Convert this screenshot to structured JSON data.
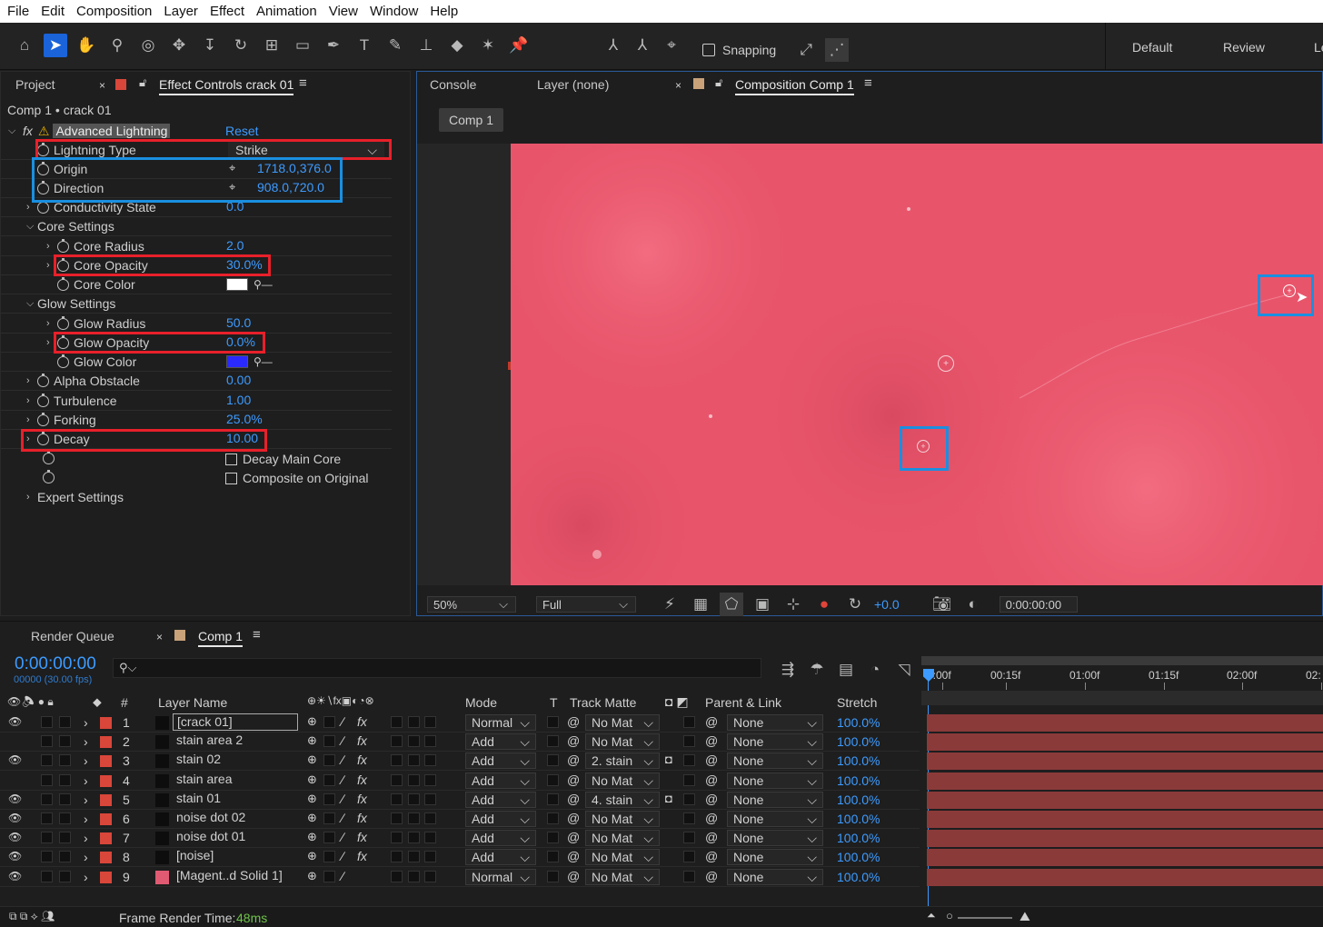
{
  "menu": [
    "File",
    "Edit",
    "Composition",
    "Layer",
    "Effect",
    "Animation",
    "View",
    "Window",
    "Help"
  ],
  "toolbar": {
    "snapping": "Snapping",
    "workspaces": [
      "Default",
      "Review",
      "Le"
    ]
  },
  "project": {
    "tab_project": "Project",
    "tab_effect": "Effect Controls crack 01",
    "breadcrumb": "Comp 1 • crack 01"
  },
  "effect": {
    "name": "Advanced Lightning",
    "reset": "Reset",
    "props": [
      {
        "label": "Lightning Type",
        "value": "Strike",
        "indent": 1,
        "chev": false
      },
      {
        "label": "Origin",
        "value": "1718.0,376.0",
        "indent": 1,
        "chev": false,
        "target": true
      },
      {
        "label": "Direction",
        "value": "908.0,720.0",
        "indent": 1,
        "chev": false,
        "target": true
      },
      {
        "label": "Conductivity State",
        "value": "0.0",
        "indent": 1,
        "chev": true
      },
      {
        "label": "Core Settings",
        "value": "",
        "indent": 0,
        "group": true
      },
      {
        "label": "Core Radius",
        "value": "2.0",
        "indent": 2,
        "chev": true
      },
      {
        "label": "Core Opacity",
        "value": "30.0%",
        "indent": 2,
        "chev": true
      },
      {
        "label": "Core Color",
        "value": "",
        "indent": 2,
        "chev": false,
        "color": "#ffffff"
      },
      {
        "label": "Glow Settings",
        "value": "",
        "indent": 0,
        "group": true
      },
      {
        "label": "Glow Radius",
        "value": "50.0",
        "indent": 2,
        "chev": true
      },
      {
        "label": "Glow Opacity",
        "value": "0.0%",
        "indent": 2,
        "chev": true
      },
      {
        "label": "Glow Color",
        "value": "",
        "indent": 2,
        "chev": false,
        "color": "#2a2aff"
      },
      {
        "label": "Alpha Obstacle",
        "value": "0.00",
        "indent": 1,
        "chev": true
      },
      {
        "label": "Turbulence",
        "value": "1.00",
        "indent": 1,
        "chev": true
      },
      {
        "label": "Forking",
        "value": "25.0%",
        "indent": 1,
        "chev": true
      },
      {
        "label": "Decay",
        "value": "10.00",
        "indent": 1,
        "chev": true
      }
    ],
    "check1": "Decay Main Core",
    "check2": "Composite on Original",
    "expert": "Expert Settings"
  },
  "comp": {
    "tab_console": "Console",
    "tab_layer": "Layer (none)",
    "tab_comp": "Composition Comp 1",
    "chip": "Comp 1",
    "zoom": "50%",
    "res": "Full",
    "exposure": "+0.0",
    "time": "0:00:00:00"
  },
  "timeline": {
    "tab_rq": "Render Queue",
    "tab_comp": "Comp 1",
    "time": "0:00:00:00",
    "fps": "00000 (30.00 fps)",
    "search_placeholder": "",
    "cols": {
      "num": "#",
      "name": "Layer Name",
      "mode": "Mode",
      "t": "T",
      "matte": "Track Matte",
      "parent": "Parent & Link",
      "stretch": "Stretch"
    },
    "ruler": [
      "0:00f",
      "00:15f",
      "01:00f",
      "01:15f",
      "02:00f",
      "02:"
    ],
    "layers": [
      {
        "n": "1",
        "name": "[crack 01]",
        "mode": "Normal",
        "matte": "No Mat",
        "parent": "None",
        "stretch": "100.0%",
        "eye": true,
        "fx": true,
        "sel": true
      },
      {
        "n": "2",
        "name": "stain area 2",
        "mode": "Add",
        "matte": "No Mat",
        "parent": "None",
        "stretch": "100.0%",
        "eye": false,
        "fx": true
      },
      {
        "n": "3",
        "name": "stain 02",
        "mode": "Add",
        "matte": "2. stain",
        "parent": "None",
        "stretch": "100.0%",
        "eye": true,
        "fx": true
      },
      {
        "n": "4",
        "name": "stain area",
        "mode": "Add",
        "matte": "No Mat",
        "parent": "None",
        "stretch": "100.0%",
        "eye": false,
        "fx": true
      },
      {
        "n": "5",
        "name": "stain 01",
        "mode": "Add",
        "matte": "4. stain",
        "parent": "None",
        "stretch": "100.0%",
        "eye": true,
        "fx": true
      },
      {
        "n": "6",
        "name": "noise dot 02",
        "mode": "Add",
        "matte": "No Mat",
        "parent": "None",
        "stretch": "100.0%",
        "eye": true,
        "fx": true
      },
      {
        "n": "7",
        "name": "noise dot 01",
        "mode": "Add",
        "matte": "No Mat",
        "parent": "None",
        "stretch": "100.0%",
        "eye": true,
        "fx": true
      },
      {
        "n": "8",
        "name": "[noise]",
        "mode": "Add",
        "matte": "No Mat",
        "parent": "None",
        "stretch": "100.0%",
        "eye": true,
        "fx": true
      },
      {
        "n": "9",
        "name": "[Magent..d Solid 1]",
        "mode": "Normal",
        "matte": "No Mat",
        "parent": "None",
        "stretch": "100.0%",
        "eye": true,
        "fx": false
      }
    ],
    "footer_label": "Frame Render Time:",
    "footer_value": "48ms"
  },
  "colors": {
    "accent": "#3d9bff",
    "highlight_red": "#e8202a",
    "highlight_blue": "#1a8fe0",
    "canvas": "#e8556b",
    "label_red": "#d9463a"
  }
}
